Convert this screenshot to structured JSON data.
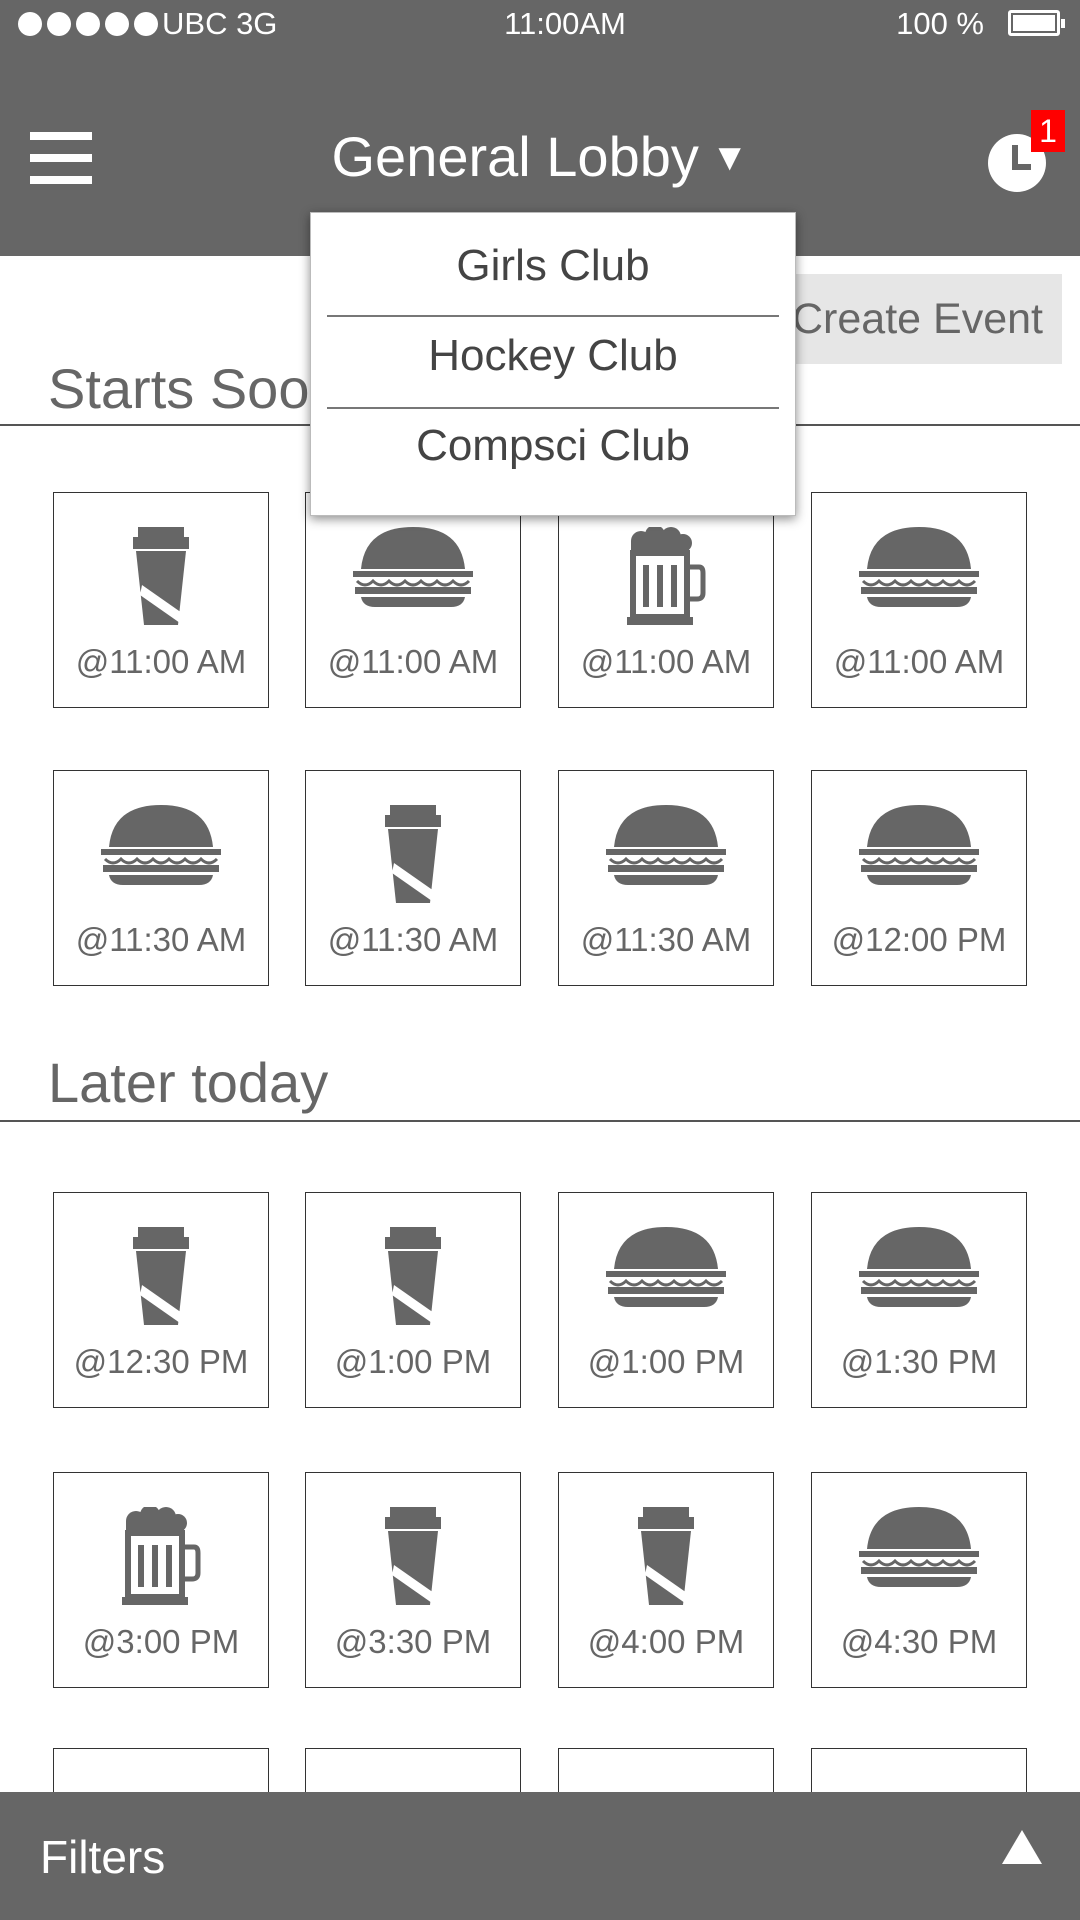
{
  "status_bar": {
    "carrier": "UBC  3G",
    "time": "11:00AM",
    "battery": "100 %"
  },
  "header": {
    "title": "General Lobby",
    "caret": "▼",
    "notification_count": "1"
  },
  "dropdown": {
    "options": [
      "Girls Club",
      "Hockey Club",
      "Compsci Club"
    ]
  },
  "actions": {
    "create_event": "Create Event"
  },
  "sections": {
    "starts_soon": {
      "title": "Starts Soon",
      "events": [
        {
          "icon": "coffee-icon",
          "time": "@11:00 AM"
        },
        {
          "icon": "burger-icon",
          "time": "@11:00 AM"
        },
        {
          "icon": "beer-icon",
          "time": "@11:00 AM"
        },
        {
          "icon": "burger-icon",
          "time": "@11:00 AM"
        },
        {
          "icon": "burger-icon",
          "time": "@11:30 AM"
        },
        {
          "icon": "coffee-icon",
          "time": "@11:30 AM"
        },
        {
          "icon": "burger-icon",
          "time": "@11:30 AM"
        },
        {
          "icon": "burger-icon",
          "time": "@12:00 PM"
        }
      ]
    },
    "later_today": {
      "title": "Later today",
      "events": [
        {
          "icon": "coffee-icon",
          "time": "@12:30 PM"
        },
        {
          "icon": "coffee-icon",
          "time": "@1:00 PM"
        },
        {
          "icon": "burger-icon",
          "time": "@1:00 PM"
        },
        {
          "icon": "burger-icon",
          "time": "@1:30 PM"
        },
        {
          "icon": "beer-icon",
          "time": "@3:00 PM"
        },
        {
          "icon": "coffee-icon",
          "time": "@3:30 PM"
        },
        {
          "icon": "coffee-icon",
          "time": "@4:00 PM"
        },
        {
          "icon": "burger-icon",
          "time": "@4:30 PM"
        }
      ]
    }
  },
  "footer": {
    "filters_label": "Filters"
  },
  "colors": {
    "bar": "#666666",
    "badge": "#ff0000",
    "button_bg": "#e6e6e6"
  }
}
